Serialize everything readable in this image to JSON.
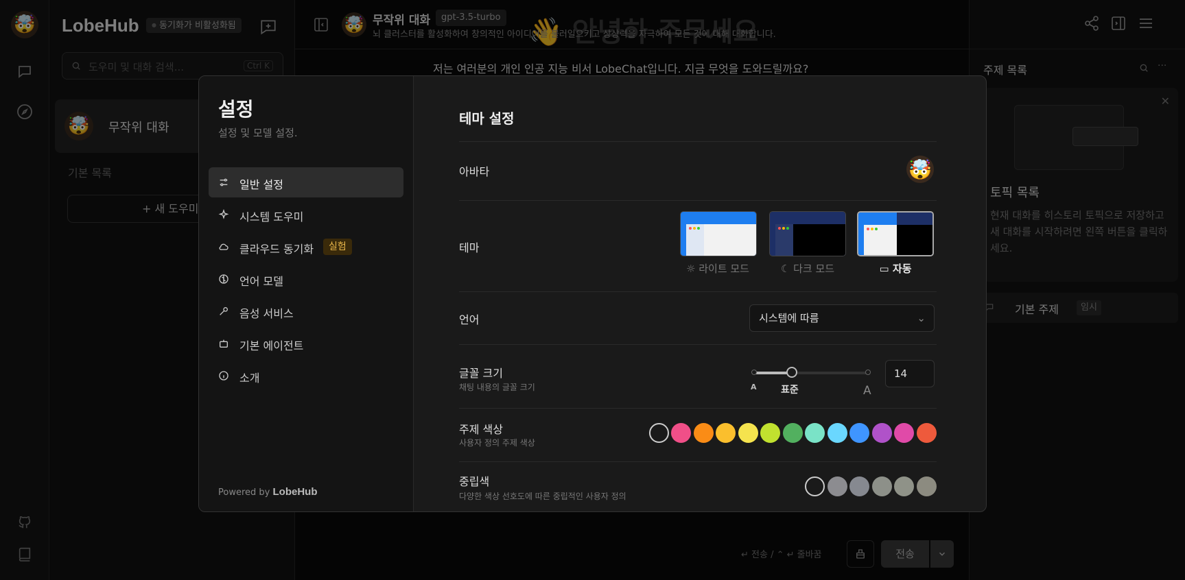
{
  "app": {
    "logo": "LobeHub",
    "sync_badge": "동기화가 비활성화됨"
  },
  "search": {
    "placeholder": "도우미 및 대화 검색...",
    "shortcut": "Ctrl K"
  },
  "sessions": {
    "active": "무작위 대화",
    "default_list": "기본 목록",
    "add_button": "+ 새 도우미"
  },
  "chat": {
    "big_title": "👋 안녕하 주무세요",
    "title": "무작위 대화",
    "model": "gpt-3.5-turbo",
    "description": "뇌 클러스터를 활성화하여 창의적인 아이디어를 불러일으키고 상상력을 자극하여 모든 것에 대해 대화합니다.",
    "message": "저는 여러분의 개인 인공 지능 비서 LobeChat입니다. 지금 무엇을 도와드릴까요?",
    "input_hint": "↵ 전송 / ⌃ ↵ 줄바꿈",
    "send": "전송"
  },
  "topics": {
    "label": "주제 목록",
    "card_title": "토픽 목록",
    "card_desc": "현재 대화를 히스토리 토픽으로 저장하고 새 대화를 시작하려면 왼쪽 버튼을 클릭하세요.",
    "default_topic": "기본 주제",
    "temp_badge": "임시"
  },
  "settings": {
    "title": "설정",
    "subtitle": "설정 및 모델 설정.",
    "nav": [
      {
        "label": "일반 설정",
        "icon": "sliders-icon"
      },
      {
        "label": "시스템 도우미",
        "icon": "sparkle-icon"
      },
      {
        "label": "클라우드 동기화",
        "icon": "cloud-icon",
        "badge": "실험"
      },
      {
        "label": "언어 모델",
        "icon": "brain-icon"
      },
      {
        "label": "음성 서비스",
        "icon": "mic-icon"
      },
      {
        "label": "기본 에이전트",
        "icon": "bot-icon"
      },
      {
        "label": "소개",
        "icon": "info-icon"
      }
    ],
    "powered_by": "Powered by",
    "powered_brand": "LobeHub",
    "section_title": "테마 설정",
    "avatar_label": "아바타",
    "theme_label": "테마",
    "theme_options": [
      "라이트 모드",
      "다크 모드",
      "자동"
    ],
    "theme_selected": "자동",
    "language_label": "언어",
    "language_value": "시스템에 따름",
    "font_label": "글꼴 크기",
    "font_desc": "채팅 내용의 글꼴 크기",
    "font_small": "A",
    "font_standard": "표준",
    "font_large": "A",
    "font_value": "14",
    "font_slider_fraction": 0.333,
    "primary_label": "주제 색상",
    "primary_desc": "사용자 정의 주제 색상",
    "primary_colors": [
      "#1a1a1a",
      "#f04f88",
      "#fa8c16",
      "#fbbf2d",
      "#f5e34e",
      "#c1e12f",
      "#52b05f",
      "#7ae3c7",
      "#6ad7fe",
      "#3f95ff",
      "#b052c9",
      "#e04aa8",
      "#ee5a3c"
    ],
    "neutral_label": "중립색",
    "neutral_desc": "다양한 색상 선호도에 따른 중립적인 사용자 정의",
    "neutral_colors": [
      "#1a1a1a",
      "#8c8c90",
      "#868990",
      "#8d9089",
      "#8f9288",
      "#8c8b80"
    ]
  }
}
